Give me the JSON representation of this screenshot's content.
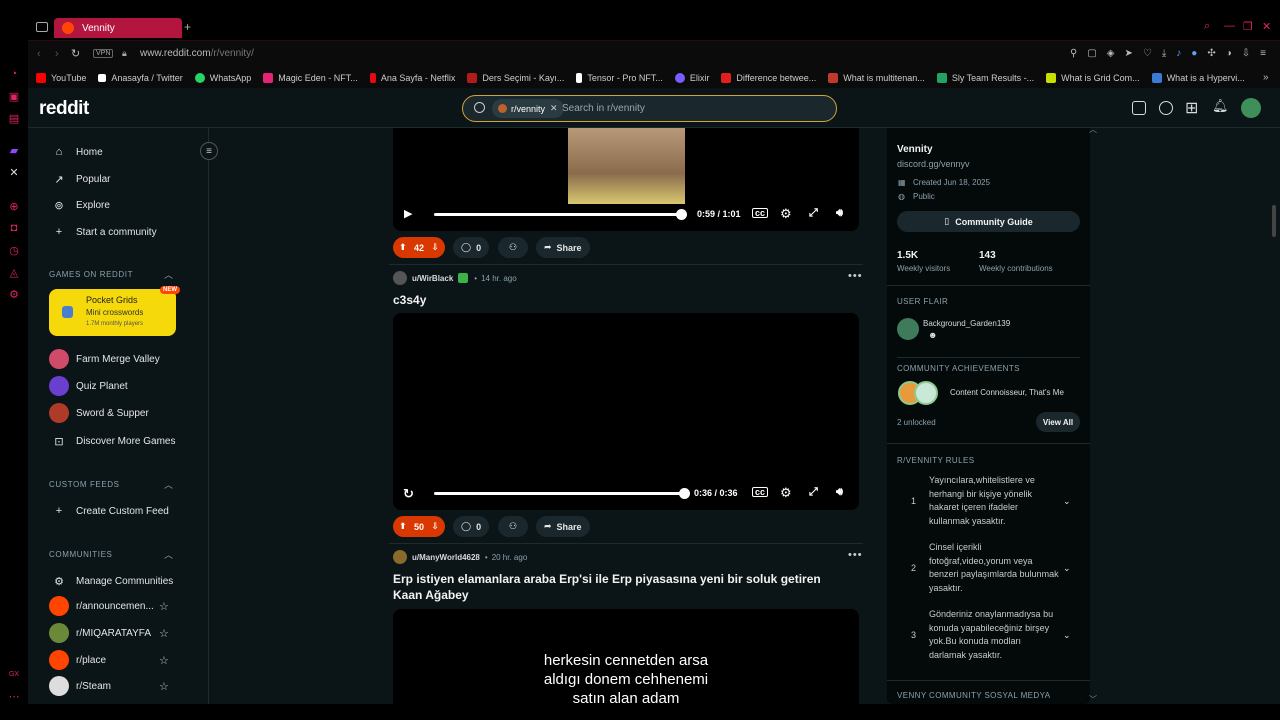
{
  "browser": {
    "tab_title": "Vennity",
    "vpn_label": "VPN",
    "url_host": "www.reddit.com",
    "url_path": "/r/vennity/",
    "bookmarks": [
      {
        "label": "YouTube",
        "color": "#ff0000"
      },
      {
        "label": "Anasayfa / Twitter",
        "color": "#ffffff"
      },
      {
        "label": "WhatsApp",
        "color": "#25d366"
      },
      {
        "label": "Magic Eden - NFT...",
        "color": "#e42575"
      },
      {
        "label": "Ana Sayfa - Netflix",
        "color": "#e50914"
      },
      {
        "label": "Ders Seçimi - Kayı...",
        "color": "#b01b1b"
      },
      {
        "label": "Tensor - Pro NFT...",
        "color": "#ffffff"
      },
      {
        "label": "Elixir",
        "color": "#7b5cff"
      },
      {
        "label": "Difference betwee...",
        "color": "#e02020"
      },
      {
        "label": "What is multitenan...",
        "color": "#c0392b"
      },
      {
        "label": "Sly Team Results -...",
        "color": "#21a366"
      },
      {
        "label": "What is Grid Com...",
        "color": "#c8e000"
      },
      {
        "label": "What is a Hypervi...",
        "color": "#3a7bd5"
      }
    ]
  },
  "reddit": {
    "logo": "reddit",
    "search_chip": "r/vennity",
    "search_placeholder": "Search in r/vennity"
  },
  "leftnav": {
    "items": [
      "Home",
      "Popular",
      "Explore",
      "Start a community"
    ],
    "games_header": "GAMES ON REDDIT",
    "pocket": {
      "title": "Pocket Grids",
      "subtitle": "Mini crosswords",
      "players": "1.7M monthly players",
      "badge": "NEW"
    },
    "games": [
      "Farm Merge Valley",
      "Quiz Planet",
      "Sword & Supper",
      "Discover More Games"
    ],
    "custom_header": "CUSTOM FEEDS",
    "create_feed": "Create Custom Feed",
    "communities_header": "COMMUNITIES",
    "manage": "Manage Communities",
    "communities": [
      "r/announcemen...",
      "r/MIQARATAYFA",
      "r/place",
      "r/Steam"
    ]
  },
  "feed": {
    "post1": {
      "time": "0:59 / 1:01",
      "votes": "42",
      "comments": "0",
      "share": "Share",
      "progress": 0.95
    },
    "post2": {
      "user": "u/WirBlack",
      "age": "14 hr. ago",
      "title": "c3s4y",
      "time": "0:36 / 0:36",
      "votes": "50",
      "comments": "0",
      "share": "Share",
      "progress": 1.0
    },
    "post3": {
      "user": "u/ManyWorld4628",
      "age": "20 hr. ago",
      "title": "Erp istiyen elamanlara araba Erp'si ile Erp piyasasına yeni bir soluk getiren Kaan Ağabey",
      "caption_l1": "herkesin cennetden arsa",
      "caption_l2": "aldıgı donem cehhenemi",
      "caption_l3": "satın alan adam"
    }
  },
  "sidebar": {
    "name": "Vennity",
    "link": "discord.gg/vennyv",
    "created": "Created Jun 18, 2025",
    "visibility": "Public",
    "guide_button": "Community Guide",
    "visitors_value": "1.5K",
    "visitors_label": "Weekly visitors",
    "contrib_value": "143",
    "contrib_label": "Weekly contributions",
    "flair_header": "USER FLAIR",
    "flair_user": "Background_Garden139",
    "achievements_header": "COMMUNITY ACHIEVEMENTS",
    "achievements_text": "Content Connoisseur, That's Me",
    "unlocked": "2 unlocked",
    "view_all": "View All",
    "rules_header": "R/VENNITY RULES",
    "rules": [
      {
        "num": "1",
        "text": "Yayıncılara,whitelistlere ve herhangi bir kişiye yönelik hakaret içeren ifadeler kullanmak yasaktır."
      },
      {
        "num": "2",
        "text": "Cinsel içerikli fotoğraf,video,yorum veya benzeri paylaşımlarda bulunmak yasaktır."
      },
      {
        "num": "3",
        "text": "Gönderiniz onaylanmadıysa bu konuda yapabileceğiniz birşey yok.Bu konuda modları darlamak yasaktır."
      }
    ],
    "social_header": "VENNY COMMUNITY SOSYAL MEDYA"
  },
  "colors": {
    "accent": "#d93900",
    "opera_red": "#e0245e",
    "bg": "#0b1416"
  }
}
